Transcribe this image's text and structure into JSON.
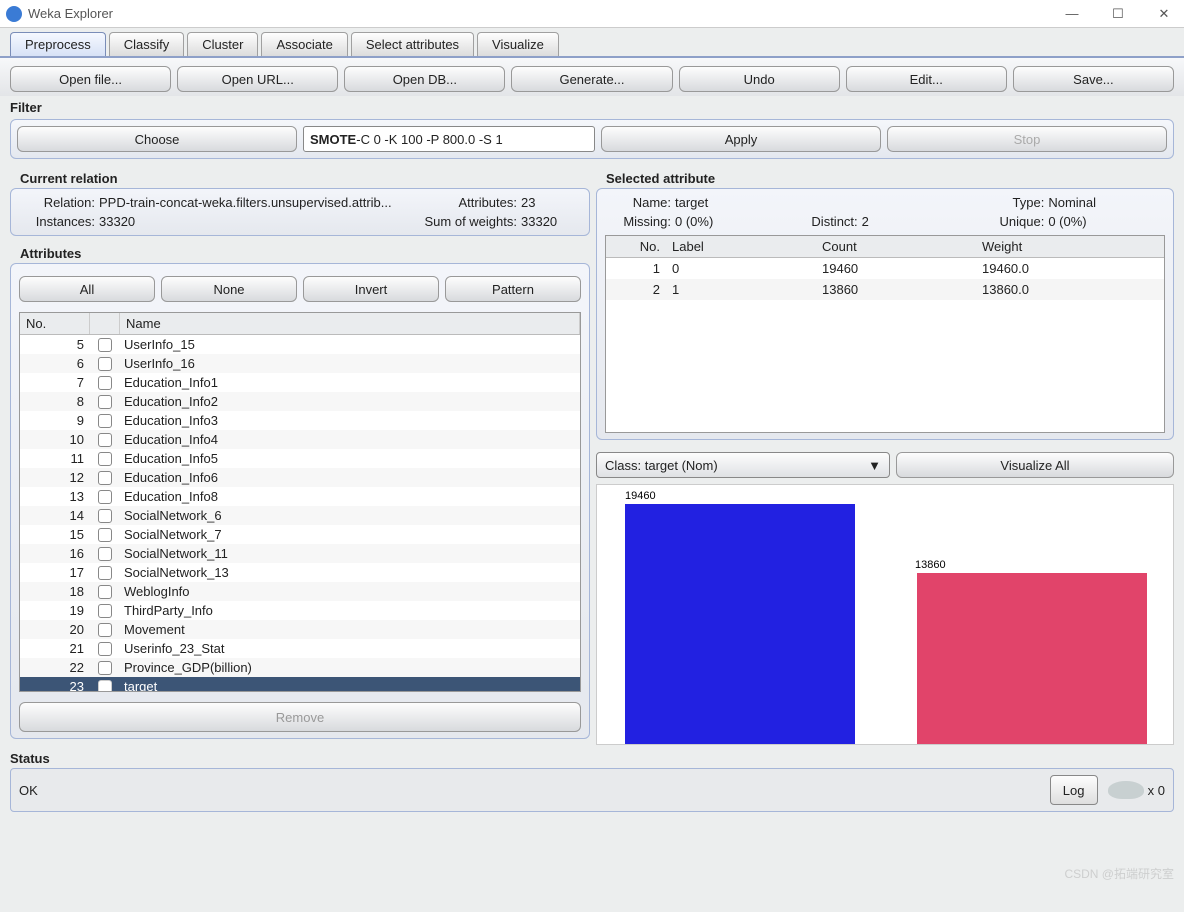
{
  "window": {
    "title": "Weka Explorer"
  },
  "tabs": [
    "Preprocess",
    "Classify",
    "Cluster",
    "Associate",
    "Select attributes",
    "Visualize"
  ],
  "toolbar": [
    "Open file...",
    "Open URL...",
    "Open DB...",
    "Generate...",
    "Undo",
    "Edit...",
    "Save..."
  ],
  "filter": {
    "section": "Filter",
    "choose": "Choose",
    "name": "SMOTE",
    "args": " -C 0 -K 100 -P 800.0 -S 1",
    "apply": "Apply",
    "stop": "Stop"
  },
  "current_relation": {
    "section": "Current relation",
    "relation_label": "Relation:",
    "relation": "PPD-train-concat-weka.filters.unsupervised.attrib...",
    "attributes_label": "Attributes:",
    "attributes": "23",
    "instances_label": "Instances:",
    "instances": "33320",
    "sum_label": "Sum of weights:",
    "sum": "33320"
  },
  "attributes": {
    "section": "Attributes",
    "btns": {
      "all": "All",
      "none": "None",
      "invert": "Invert",
      "pattern": "Pattern"
    },
    "hdr_no": "No.",
    "hdr_name": "Name",
    "rows": [
      {
        "no": 5,
        "name": "UserInfo_15"
      },
      {
        "no": 6,
        "name": "UserInfo_16"
      },
      {
        "no": 7,
        "name": "Education_Info1"
      },
      {
        "no": 8,
        "name": "Education_Info2"
      },
      {
        "no": 9,
        "name": "Education_Info3"
      },
      {
        "no": 10,
        "name": "Education_Info4"
      },
      {
        "no": 11,
        "name": "Education_Info5"
      },
      {
        "no": 12,
        "name": "Education_Info6"
      },
      {
        "no": 13,
        "name": "Education_Info8"
      },
      {
        "no": 14,
        "name": "SocialNetwork_6"
      },
      {
        "no": 15,
        "name": "SocialNetwork_7"
      },
      {
        "no": 16,
        "name": "SocialNetwork_11"
      },
      {
        "no": 17,
        "name": "SocialNetwork_13"
      },
      {
        "no": 18,
        "name": "WeblogInfo"
      },
      {
        "no": 19,
        "name": "ThirdParty_Info"
      },
      {
        "no": 20,
        "name": "Movement"
      },
      {
        "no": 21,
        "name": "Userinfo_23_Stat"
      },
      {
        "no": 22,
        "name": "Province_GDP(billion)"
      },
      {
        "no": 23,
        "name": "target",
        "selected": true
      }
    ],
    "remove": "Remove"
  },
  "selected_attribute": {
    "section": "Selected attribute",
    "name_label": "Name:",
    "name": "target",
    "type_label": "Type:",
    "type": "Nominal",
    "missing_label": "Missing:",
    "missing": "0 (0%)",
    "distinct_label": "Distinct:",
    "distinct": "2",
    "unique_label": "Unique:",
    "unique": "0 (0%)",
    "hdr": {
      "no": "No.",
      "label": "Label",
      "count": "Count",
      "weight": "Weight"
    },
    "rows": [
      {
        "no": 1,
        "label": "0",
        "count": "19460",
        "weight": "19460.0"
      },
      {
        "no": 2,
        "label": "1",
        "count": "13860",
        "weight": "13860.0"
      }
    ]
  },
  "class_selector": {
    "value": "Class: target (Nom)",
    "visall": "Visualize All"
  },
  "chart_data": {
    "type": "bar",
    "categories": [
      "0",
      "1"
    ],
    "values": [
      19460,
      13860
    ],
    "colors": [
      "#2221e1",
      "#e1446a"
    ],
    "ylim": [
      0,
      19460
    ]
  },
  "status": {
    "section": "Status",
    "text": "OK",
    "log": "Log",
    "x": "x 0"
  },
  "watermark": "CSDN @拓端研究室"
}
